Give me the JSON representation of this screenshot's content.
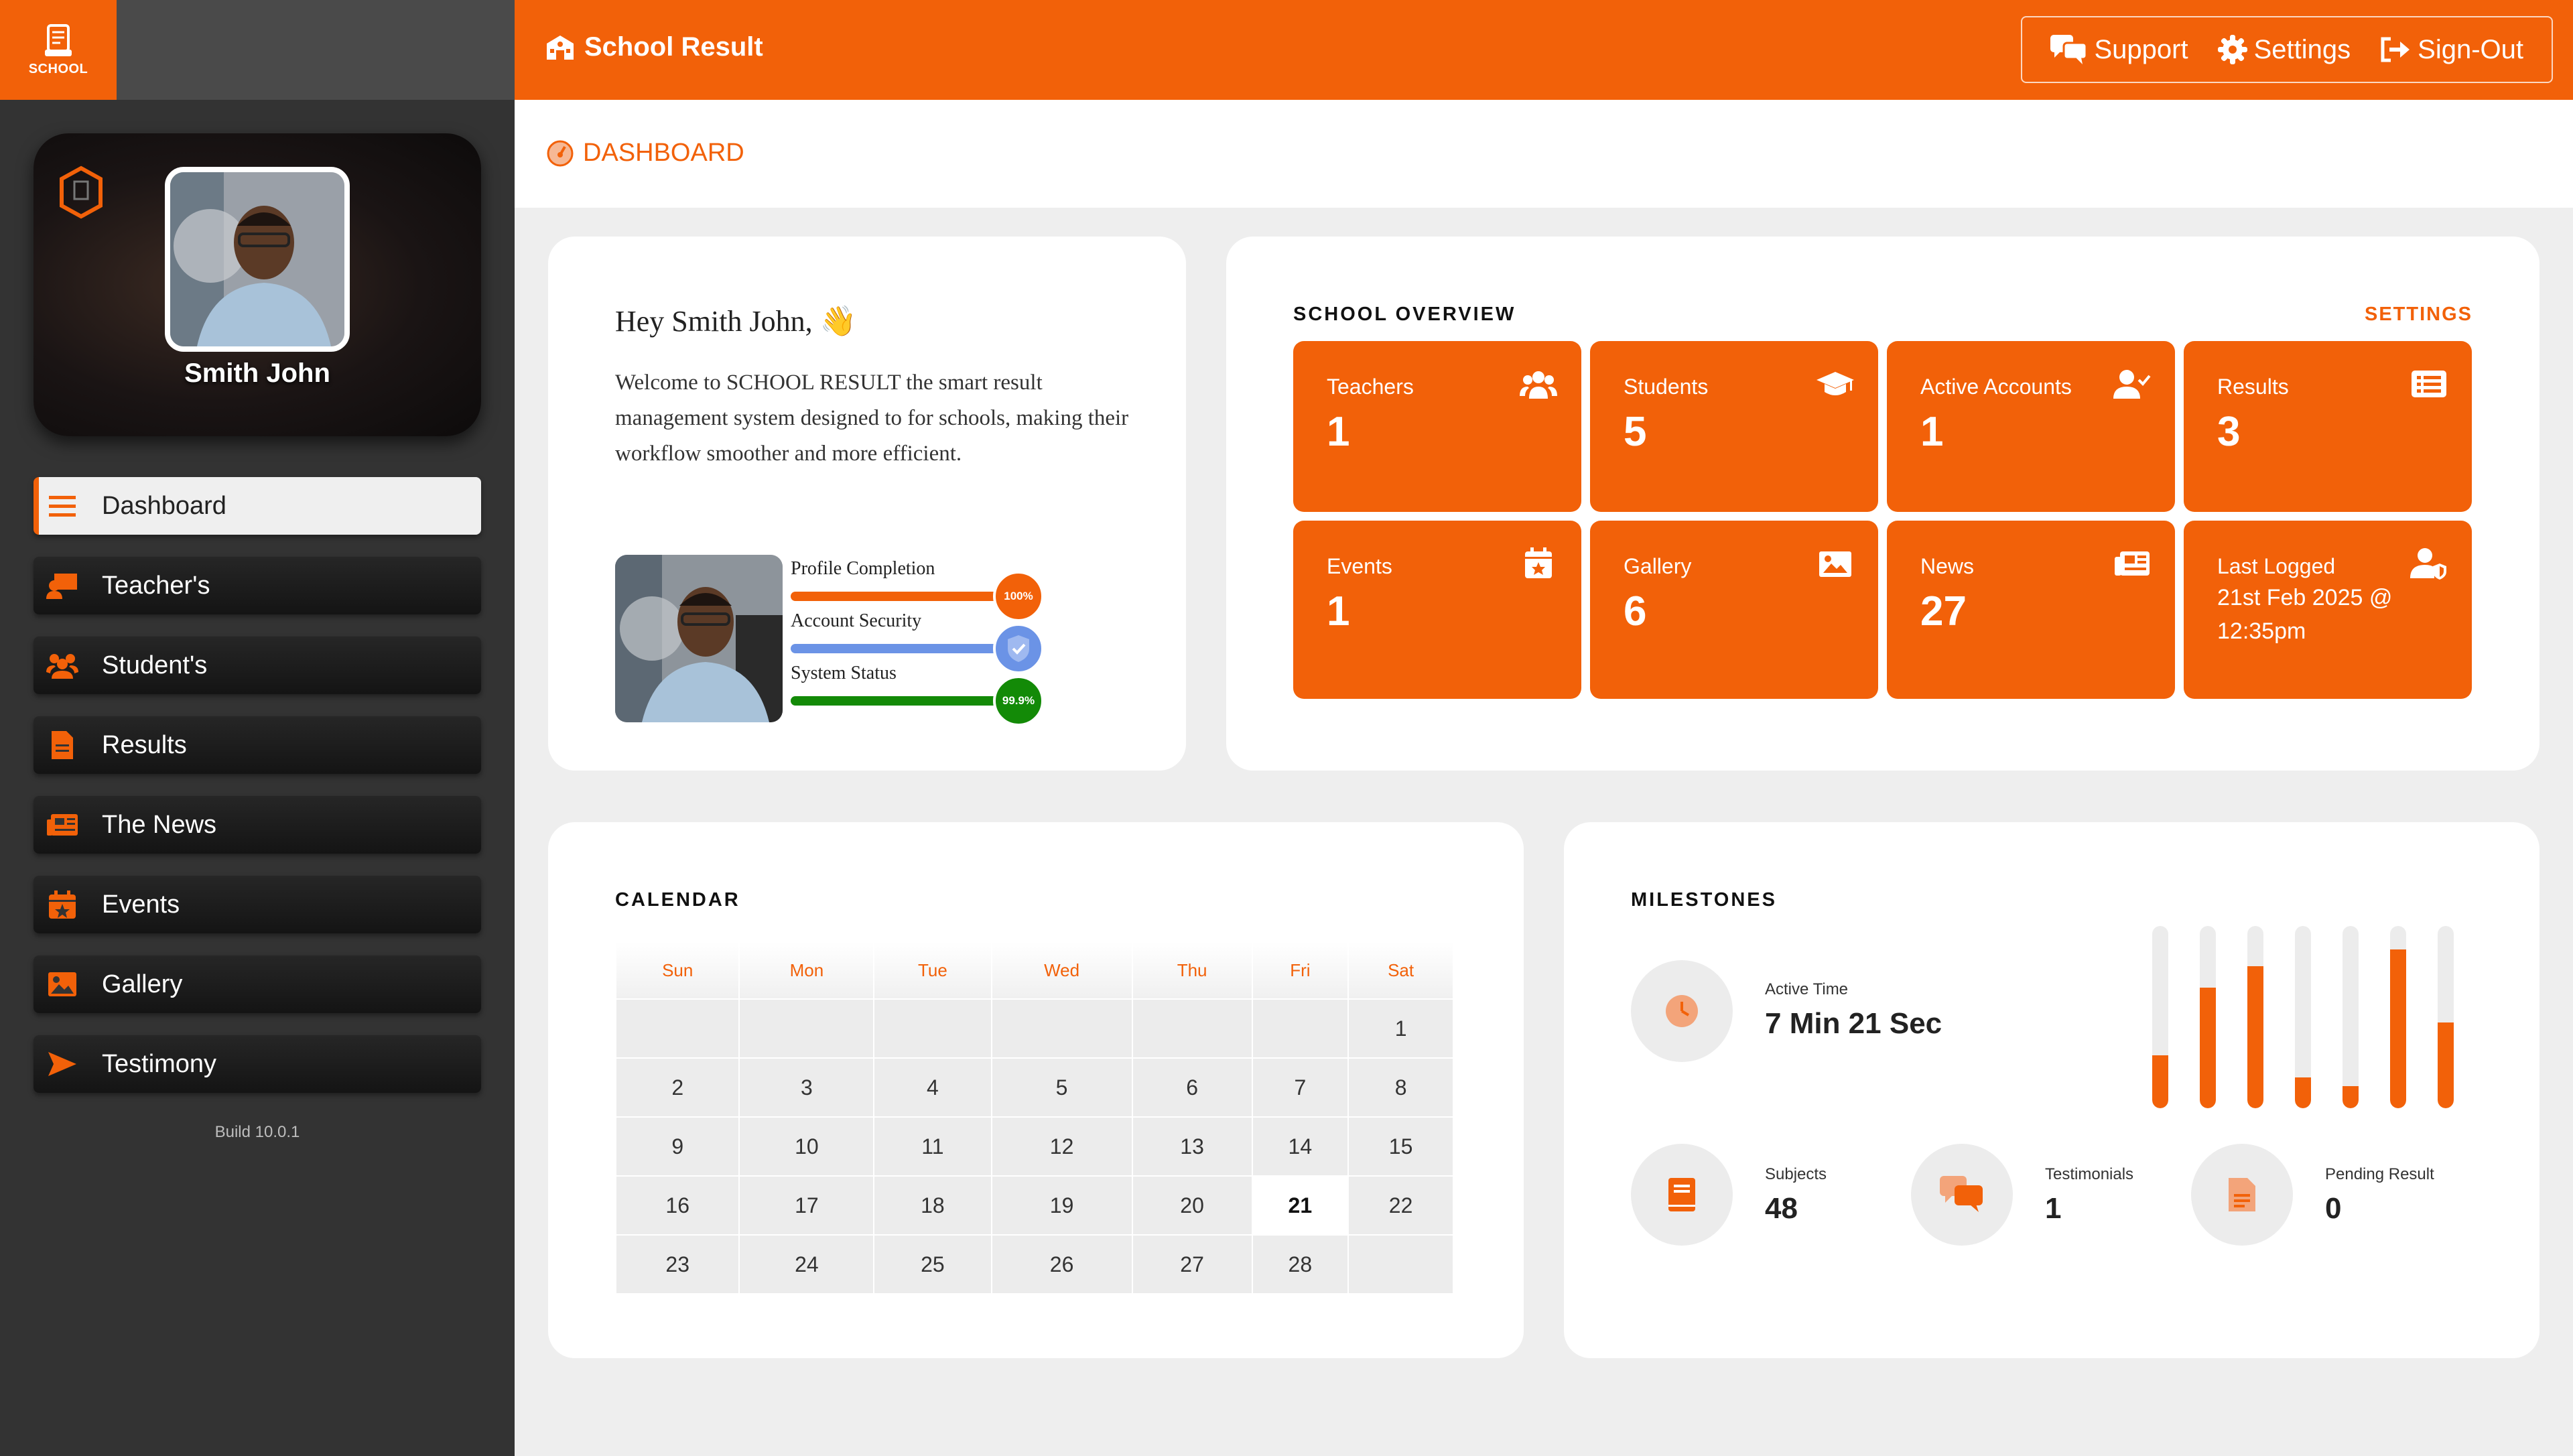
{
  "brand": {
    "box_label": "SCHOOL",
    "app_title": "School Result"
  },
  "top_actions": [
    {
      "label": "Support",
      "icon": "chat-icon"
    },
    {
      "label": "Settings",
      "icon": "gear-icon"
    },
    {
      "label": "Sign-Out",
      "icon": "sign-out-icon"
    }
  ],
  "breadcrumb": {
    "label": "DASHBOARD"
  },
  "profile": {
    "name": "Smith John"
  },
  "sidebar": {
    "items": [
      {
        "label": "Dashboard",
        "icon": "menu-icon",
        "active": true
      },
      {
        "label": "Teacher's",
        "icon": "teacher-icon"
      },
      {
        "label": "Student's",
        "icon": "students-icon"
      },
      {
        "label": "Results",
        "icon": "document-icon"
      },
      {
        "label": "The News",
        "icon": "newspaper-icon"
      },
      {
        "label": "Events",
        "icon": "calendar-icon"
      },
      {
        "label": "Gallery",
        "icon": "image-icon"
      },
      {
        "label": "Testimony",
        "icon": "send-icon"
      }
    ],
    "build": "Build 10.0.1"
  },
  "welcome": {
    "greeting": "Hey Smith John,",
    "wave_emoji": "👋",
    "message": "Welcome to SCHOOL RESULT the smart result management system designed to for schools, making their workflow smoother and more efficient.",
    "status": [
      {
        "label": "Profile Completion",
        "badge": "100%",
        "color": "#f26109"
      },
      {
        "label": "Account Security",
        "badge": "",
        "color": "#6b93e6"
      },
      {
        "label": "System Status",
        "badge": "99.9%",
        "color": "#138a07"
      }
    ]
  },
  "overview": {
    "title": "SCHOOL OVERVIEW",
    "settings_link": "SETTINGS",
    "tiles": [
      {
        "label": "Teachers",
        "value": "1",
        "icon": "users-icon"
      },
      {
        "label": "Students",
        "value": "5",
        "icon": "graduation-cap-icon"
      },
      {
        "label": "Active Accounts",
        "value": "1",
        "icon": "user-check-icon"
      },
      {
        "label": "Results",
        "value": "3",
        "icon": "list-icon"
      },
      {
        "label": "Events",
        "value": "1",
        "icon": "calendar-star-icon"
      },
      {
        "label": "Gallery",
        "value": "6",
        "icon": "image-icon"
      },
      {
        "label": "News",
        "value": "27",
        "icon": "newspaper-icon"
      },
      {
        "label": "Last Logged",
        "value": "21st Feb 2025 @ 12:35pm",
        "icon": "user-shield-icon"
      }
    ]
  },
  "calendar": {
    "title": "CALENDAR",
    "days": [
      "Sun",
      "Mon",
      "Tue",
      "Wed",
      "Thu",
      "Fri",
      "Sat"
    ],
    "weeks": [
      [
        "",
        "",
        "",
        "",
        "",
        "",
        "1"
      ],
      [
        "2",
        "3",
        "4",
        "5",
        "6",
        "7",
        "8"
      ],
      [
        "9",
        "10",
        "11",
        "12",
        "13",
        "14",
        "15"
      ],
      [
        "16",
        "17",
        "18",
        "19",
        "20",
        "21",
        "22"
      ],
      [
        "23",
        "24",
        "25",
        "26",
        "27",
        "28",
        ""
      ]
    ],
    "today": "21"
  },
  "milestones": {
    "title": "MILESTONES",
    "active_time": {
      "label": "Active Time",
      "value": "7 Min 21 Sec",
      "icon": "clock-icon"
    },
    "stats": [
      {
        "label": "Subjects",
        "value": "48",
        "icon": "book-icon"
      },
      {
        "label": "Testimonials",
        "value": "1",
        "icon": "comments-icon"
      },
      {
        "label": "Pending Result",
        "value": "0",
        "icon": "file-icon"
      }
    ],
    "activity_levels": [
      0.29,
      0.66,
      0.78,
      0.17,
      0.12,
      0.87,
      0.47
    ]
  }
}
